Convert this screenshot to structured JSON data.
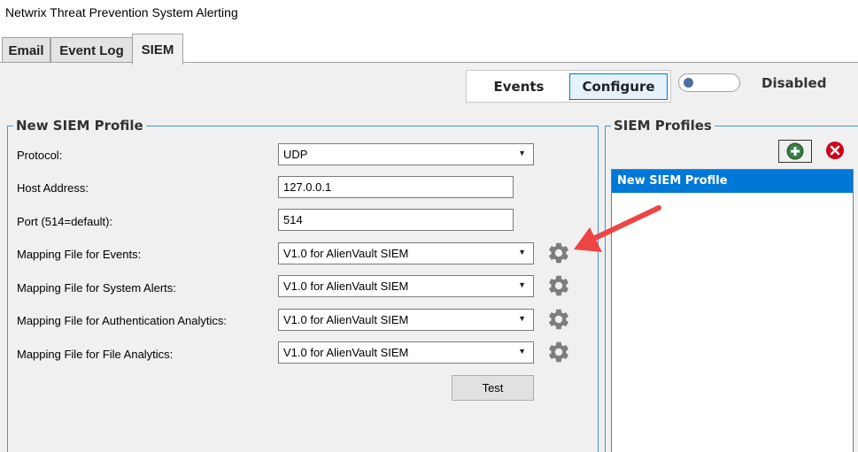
{
  "window": {
    "title": "Netwrix Threat Prevention System Alerting"
  },
  "tabs": [
    {
      "label": "Email",
      "active": false
    },
    {
      "label": "Event Log",
      "active": false
    },
    {
      "label": "SIEM",
      "active": true
    }
  ],
  "toolbar": {
    "events_label": "Events",
    "configure_label": "Configure",
    "toggle_state": "Disabled"
  },
  "new_profile": {
    "title": "New SIEM Profile",
    "protocol": {
      "label": "Protocol:",
      "value": "UDP"
    },
    "host": {
      "label": "Host Address:",
      "value": "127.0.0.1"
    },
    "port": {
      "label": "Port (514=default):",
      "value": "514"
    },
    "mapping_events": {
      "label": "Mapping File for Events:",
      "value": "V1.0 for AlienVault SIEM"
    },
    "mapping_system_alerts": {
      "label": "Mapping File for System Alerts:",
      "value": "V1.0 for AlienVault SIEM"
    },
    "mapping_auth_analytics": {
      "label": "Mapping File for Authentication Analytics:",
      "value": "V1.0 for AlienVault SIEM"
    },
    "mapping_file_analytics": {
      "label": "Mapping File for File Analytics:",
      "value": "V1.0 for AlienVault SIEM"
    },
    "test_label": "Test"
  },
  "profiles": {
    "title": "SIEM Profiles",
    "items": [
      {
        "label": "New SIEM Profile",
        "selected": true
      }
    ]
  },
  "icons": {
    "gear": "gear-icon",
    "add": "add-circle-icon",
    "remove": "remove-circle-icon",
    "dropdown": "chevron-down-icon",
    "annotation": "red-arrow-icon"
  },
  "colors": {
    "accent": "#0078d7",
    "group_border": "#4a90d9",
    "panel_bg": "#f0f0f0",
    "annotation_arrow": "#ef4444",
    "remove_red": "#d0021b",
    "add_green": "#3a7d44"
  }
}
